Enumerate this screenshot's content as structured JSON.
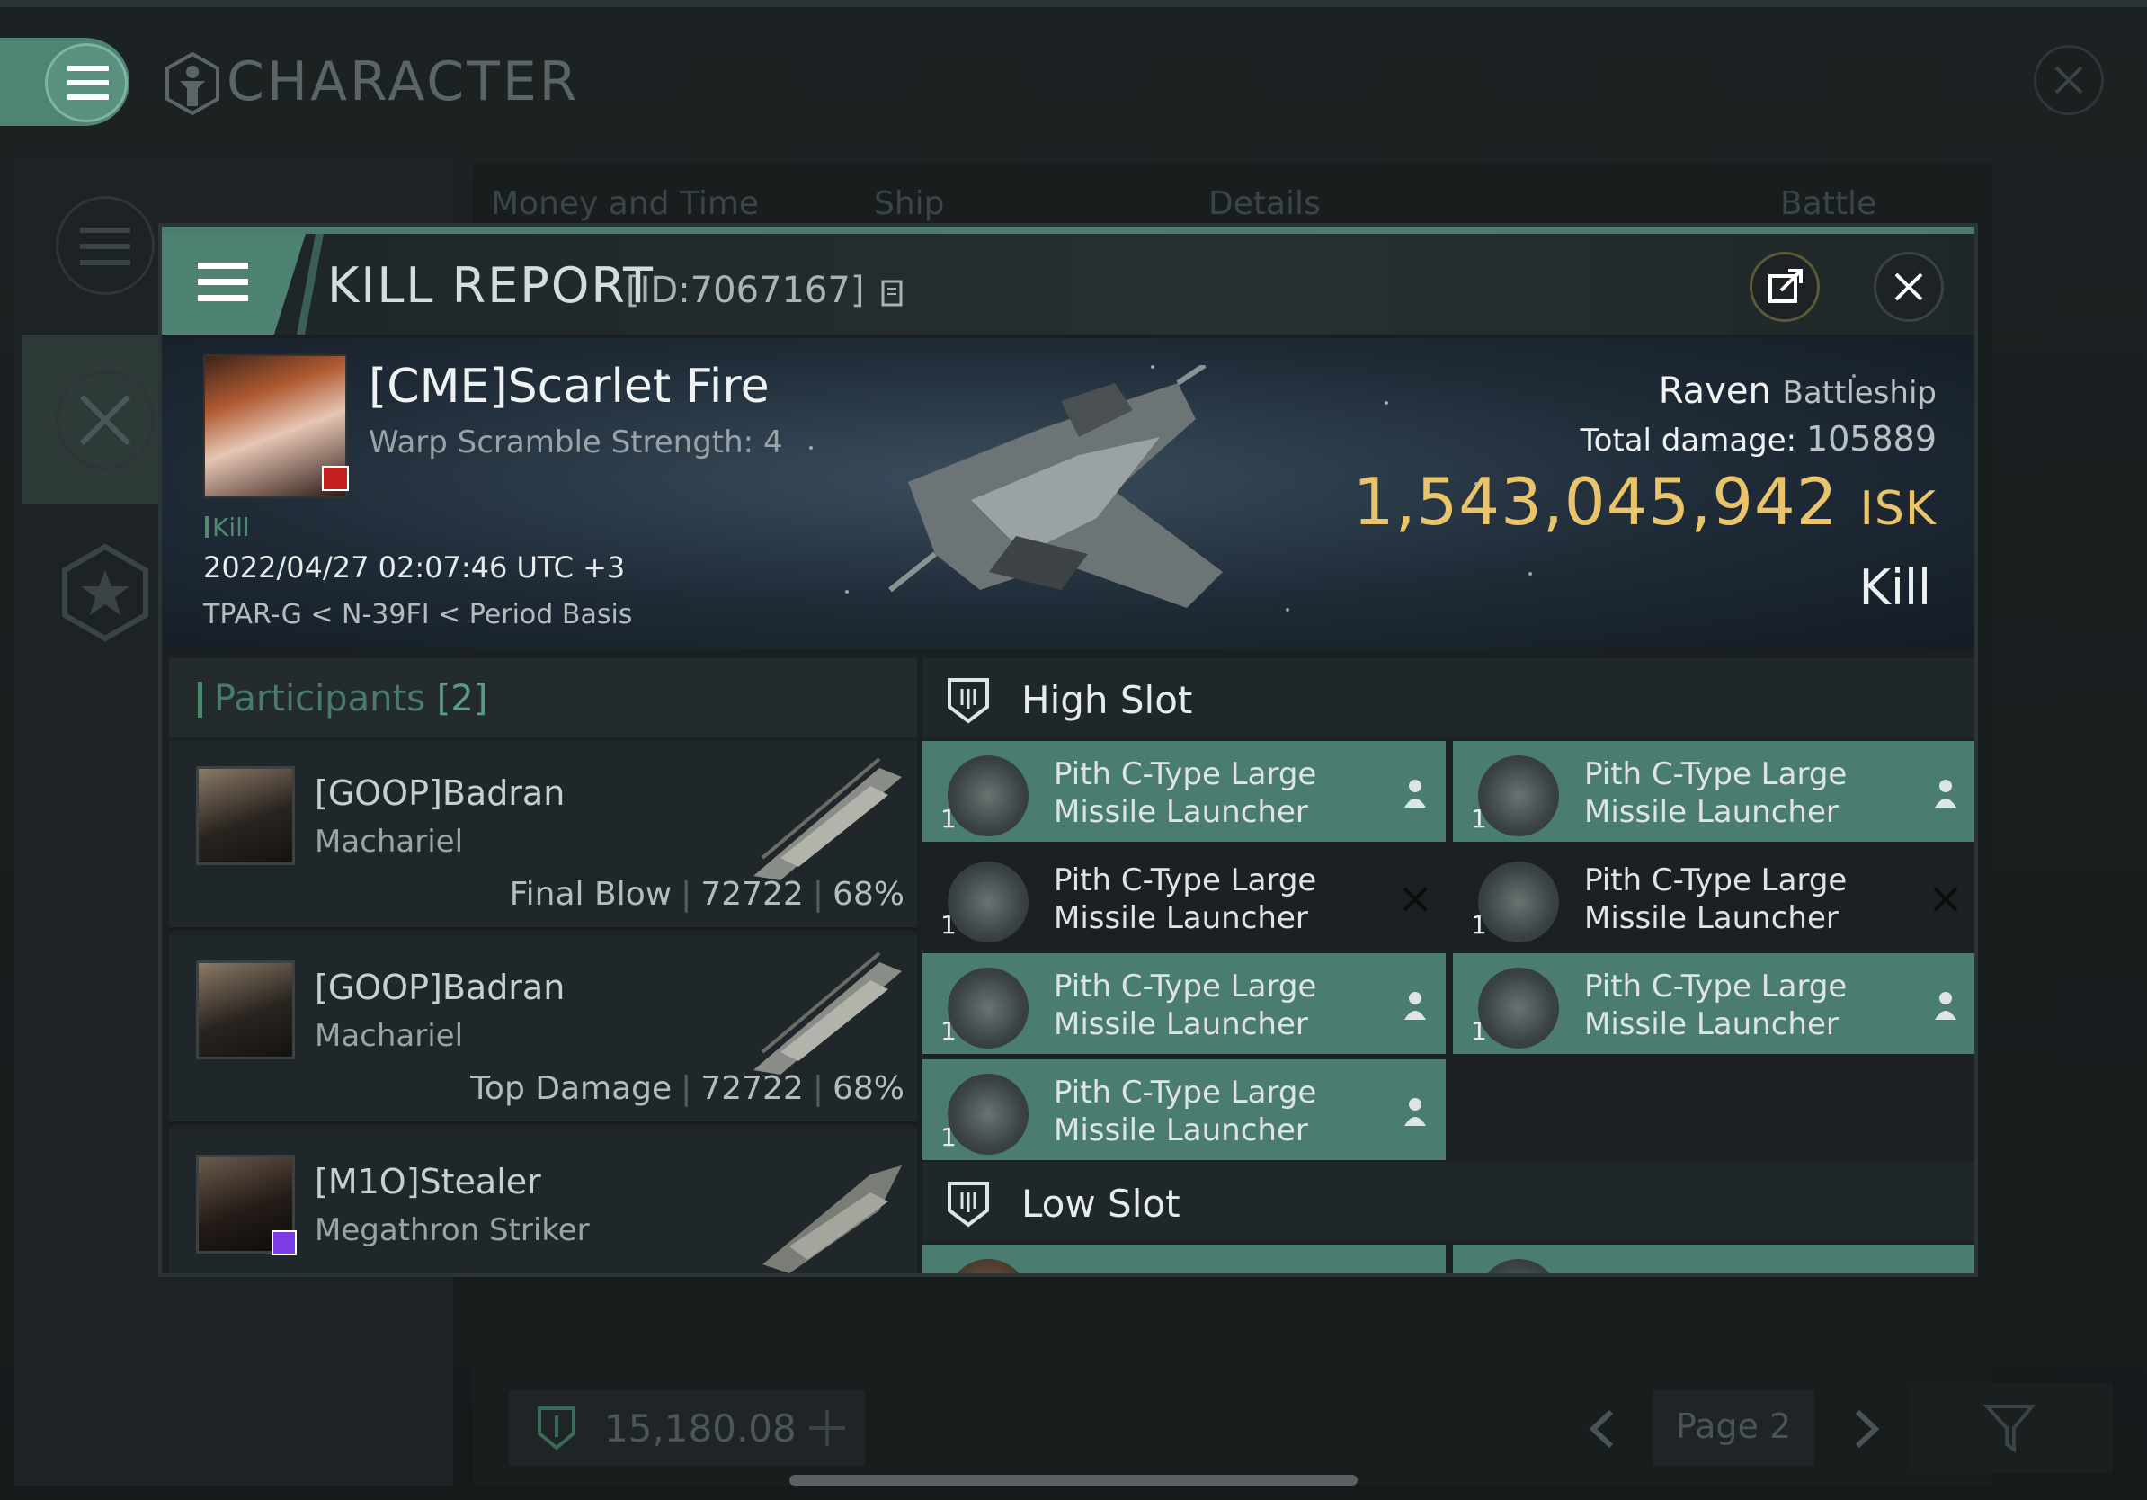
{
  "app": {
    "title": "CHARACTER",
    "bg_tabs": [
      "Money and Time",
      "Ship",
      "Details",
      "Battle Status"
    ],
    "currency_value": "15,180.08",
    "page_label": "Page 2"
  },
  "modal": {
    "title": "KILL REPORT",
    "id_label": "[ID:7067167]",
    "victim": {
      "name": "[CME]Scarlet Fire",
      "warp_scramble": "Warp Scramble Strength: 4",
      "status": "Kill",
      "timestamp": "2022/04/27 02:07:46 UTC +3",
      "location": "TPAR-G < N-39FI < Period Basis"
    },
    "ship": {
      "name": "Raven",
      "class": "Battleship",
      "total_damage_label": "Total damage:",
      "total_damage": "105889",
      "isk_value": "1,543,045,942",
      "isk_unit": "ISK",
      "result": "Kill"
    },
    "participants": {
      "title": "Participants",
      "count": "[2]",
      "rows": [
        {
          "name": "[GOOP]Badran",
          "ship": "Machariel",
          "role": "Final Blow",
          "damage": "72722",
          "percent": "68%"
        },
        {
          "name": "[GOOP]Badran",
          "ship": "Machariel",
          "role": "Top Damage",
          "damage": "72722",
          "percent": "68%"
        },
        {
          "name": "[M1O]Stealer",
          "ship": "Megathron Striker",
          "role": "",
          "damage": "",
          "percent": ""
        }
      ]
    },
    "slots": {
      "high_title": "High Slot",
      "low_title": "Low Slot",
      "high_modules": [
        {
          "line1": "Pith C-Type Large",
          "line2": "Missile Launcher",
          "qty": "1",
          "state": "dropped"
        },
        {
          "line1": "Pith C-Type Large",
          "line2": "Missile Launcher",
          "qty": "1",
          "state": "dropped"
        },
        {
          "line1": "Pith C-Type Large",
          "line2": "Missile Launcher",
          "qty": "1",
          "state": "destroyed"
        },
        {
          "line1": "Pith C-Type Large",
          "line2": "Missile Launcher",
          "qty": "1",
          "state": "destroyed"
        },
        {
          "line1": "Pith C-Type Large",
          "line2": "Missile Launcher",
          "qty": "1",
          "state": "dropped"
        },
        {
          "line1": "Pith C-Type Large",
          "line2": "Missile Launcher",
          "qty": "1",
          "state": "dropped"
        },
        {
          "line1": "Pith C-Type Large",
          "line2": "Missile Launcher",
          "qty": "1",
          "state": "dropped"
        }
      ]
    }
  },
  "colors": {
    "accent": "#4b7c70",
    "isk": "#e9c46a",
    "background": "#141819"
  }
}
